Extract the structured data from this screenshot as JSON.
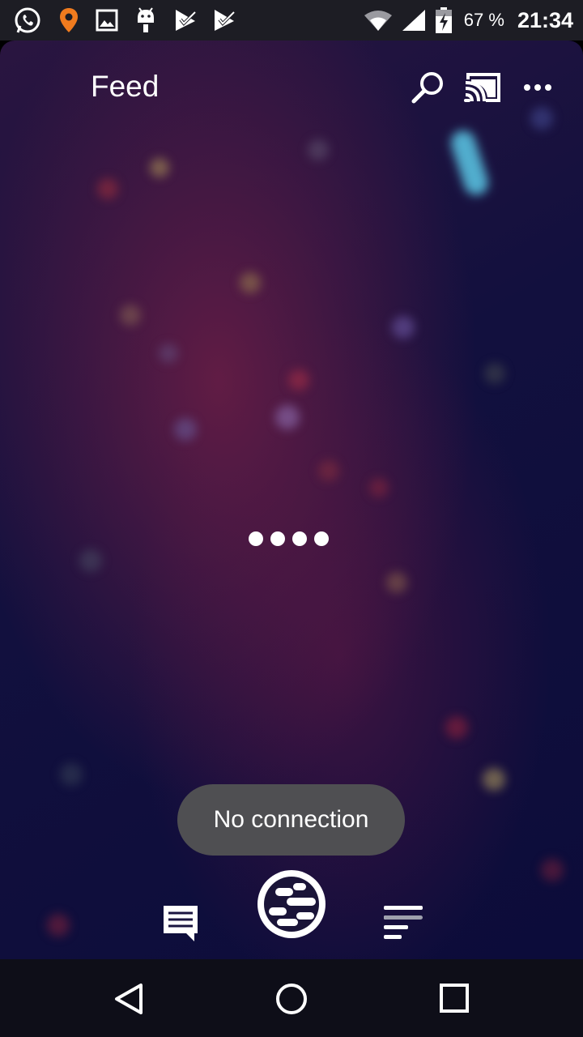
{
  "status_bar": {
    "notification_icons": [
      "whatsapp-icon",
      "location-pin-icon",
      "gallery-icon",
      "android-debug-icon",
      "task-check-icon",
      "task-check-icon-2"
    ],
    "battery_percent": "67 %",
    "time": "21:34",
    "accent_color": "#f07b1e"
  },
  "header": {
    "title": "Feed",
    "actions": [
      "search-icon",
      "cast-icon",
      "more-icon"
    ]
  },
  "toast": {
    "message": "No connection"
  },
  "bottom_nav": {
    "items": [
      "messages-icon",
      "planet-icon",
      "menu-list-icon"
    ],
    "active": "menu-list-icon"
  },
  "system_nav": {
    "buttons": [
      "back-icon",
      "home-icon",
      "recents-icon"
    ]
  }
}
